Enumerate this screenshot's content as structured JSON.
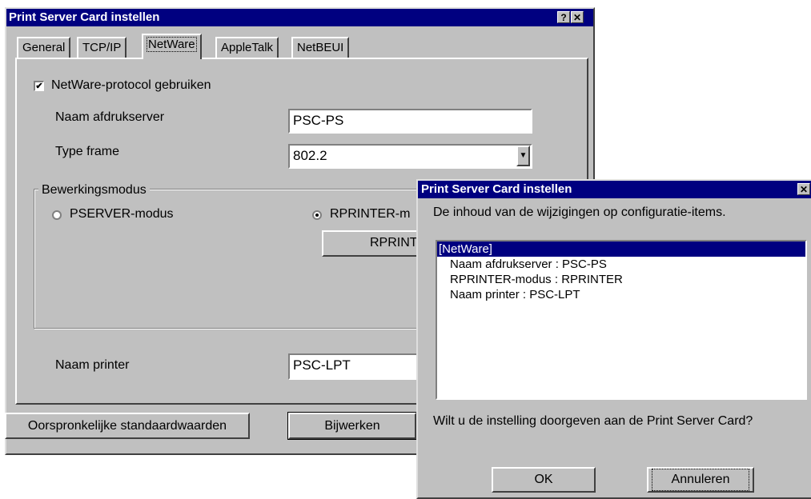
{
  "main": {
    "title": "Print Server Card instellen",
    "help_btn": "?",
    "close_btn": "✕",
    "tabs": [
      {
        "label": "General"
      },
      {
        "label": "TCP/IP"
      },
      {
        "label": "NetWare"
      },
      {
        "label": "AppleTalk"
      },
      {
        "label": "NetBEUI"
      }
    ],
    "use_protocol": {
      "label": "NetWare-protocol gebruiken",
      "checked": true,
      "mark": "✔"
    },
    "server_name": {
      "label": "Naam afdrukserver",
      "value": "PSC-PS"
    },
    "frame_type": {
      "label": "Type frame",
      "value": "802.2",
      "arrow": "▼"
    },
    "mode_group": {
      "label": "Bewerkingsmodus"
    },
    "pserver": {
      "label": "PSERVER-modus",
      "selected": false
    },
    "rprinter": {
      "label": "RPRINTER-m",
      "selected": true
    },
    "rprinter_button": "RPRINT",
    "printer_name": {
      "label": "Naam printer",
      "value": "PSC-LPT"
    },
    "defaults_button": "Oorspronkelijke standaardwaarden",
    "update_button": "Bijwerken"
  },
  "dialog": {
    "title": "Print Server Card instellen",
    "close_btn": "✕",
    "message": "De inhoud van de wijzigingen op configuratie-items.",
    "changes": [
      {
        "text": "[NetWare]",
        "selected": true
      },
      {
        "text": "Naam afdrukserver : PSC-PS"
      },
      {
        "text": "RPRINTER-modus : RPRINTER"
      },
      {
        "text": "Naam printer : PSC-LPT"
      }
    ],
    "question": "Wilt u de instelling doorgeven aan de Print Server Card?",
    "ok_button": "OK",
    "cancel_button": "Annuleren"
  },
  "colors": {
    "titlebar": "#000080",
    "face": "#c0c0c0"
  }
}
